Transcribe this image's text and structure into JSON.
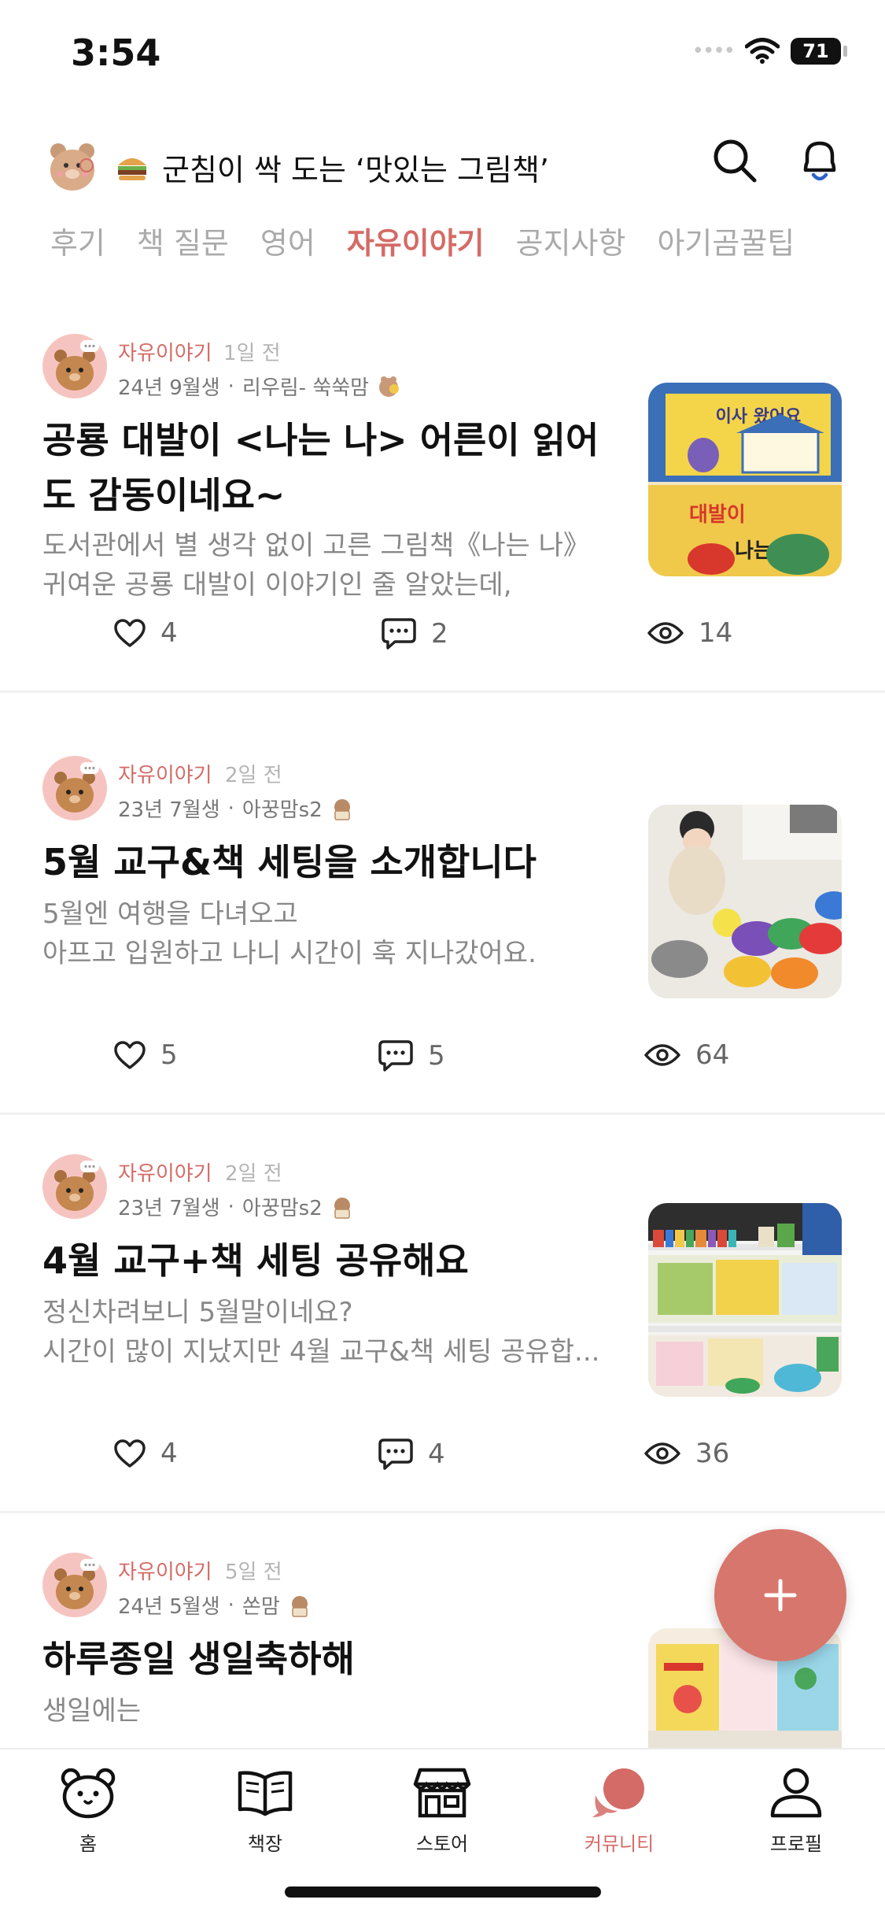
{
  "status_bar": {
    "time": "3:54",
    "battery": "71"
  },
  "header": {
    "title": "군침이 싹 도는 ‘맛있는 그림책’",
    "mascot_icon": "bear-mascot-icon",
    "emoji_icon": "hamburger-icon"
  },
  "tabs": [
    {
      "label": "후기",
      "active": false
    },
    {
      "label": "책 질문",
      "active": false
    },
    {
      "label": "영어",
      "active": false
    },
    {
      "label": "자유이야기",
      "active": true
    },
    {
      "label": "공지사항",
      "active": false
    },
    {
      "label": "아기곰꿀팁",
      "active": false
    }
  ],
  "posts": [
    {
      "category": "자유이야기",
      "time": "1일 전",
      "birth": "24년 9월생",
      "separator": "·",
      "author": "리우림- 쑥쑥맘",
      "title_lines": [
        "공룡 대발이 <나는 나> 어른이 읽어",
        "도 감동이네요~"
      ],
      "excerpt": [
        "도서관에서 별 생각 없이 고른 그림책《나는 나》",
        "귀여운 공룡 대발이 이야기인 줄 알았는데,"
      ],
      "likes": "4",
      "comments": "2",
      "views": "14"
    },
    {
      "category": "자유이야기",
      "time": "2일 전",
      "birth": "23년 7월생",
      "separator": "·",
      "author": "아꿍맘s2",
      "title_lines": [
        "5월 교구&책 세팅을 소개합니다"
      ],
      "excerpt": [
        "5월엔 여행을 다녀오고",
        "아프고 입원하고 나니 시간이 훅 지나갔어요."
      ],
      "likes": "5",
      "comments": "5",
      "views": "64"
    },
    {
      "category": "자유이야기",
      "time": "2일 전",
      "birth": "23년 7월생",
      "separator": "·",
      "author": "아꿍맘s2",
      "title_lines": [
        "4월 교구+책 세팅 공유해요"
      ],
      "excerpt": [
        "정신차려보니 5월말이네요?",
        "시간이 많이 지났지만 4월 교구&책 세팅 공유합..."
      ],
      "likes": "4",
      "comments": "4",
      "views": "36"
    },
    {
      "category": "자유이야기",
      "time": "5일 전",
      "birth": "24년 5월생",
      "separator": "·",
      "author": "쏜맘",
      "title_lines": [
        "하루종일 생일축하해"
      ],
      "excerpt": [
        "생일에는"
      ],
      "likes": "",
      "comments": "",
      "views": ""
    }
  ],
  "thumb_text": {
    "book1": "이사 왔어요",
    "book2": "나는 나",
    "brand": "대발이"
  },
  "fab": {
    "label": "+"
  },
  "bottom_nav": [
    {
      "label": "홈",
      "icon": "bear-home-icon",
      "active": false
    },
    {
      "label": "책장",
      "icon": "open-book-icon",
      "active": false
    },
    {
      "label": "스토어",
      "icon": "store-icon",
      "active": false
    },
    {
      "label": "커뮤니티",
      "icon": "chat-bubble-icon",
      "active": true
    },
    {
      "label": "프로필",
      "icon": "person-icon",
      "active": false
    }
  ],
  "colors": {
    "accent": "#d46b66",
    "fab": "#d7766d",
    "muted": "#888888"
  }
}
